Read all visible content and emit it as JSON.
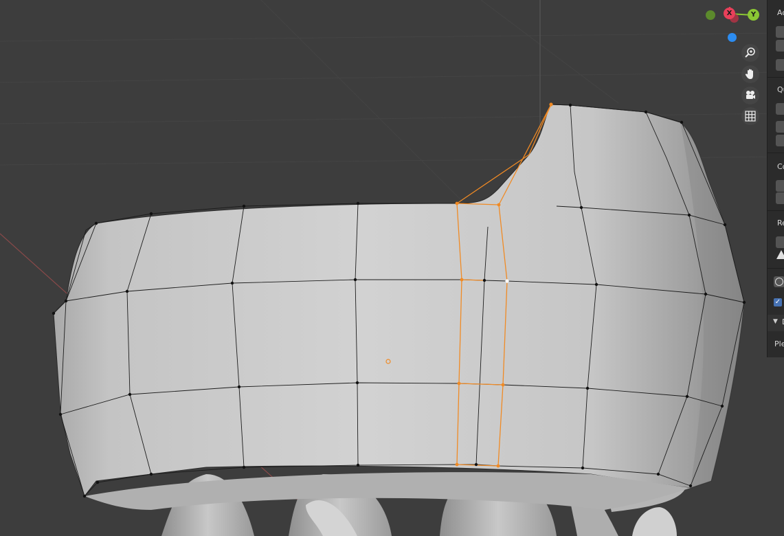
{
  "gizmo": {
    "x_label": "X",
    "y_label": "Y",
    "colors": {
      "x": "#e8405a",
      "y": "#8bc734",
      "z": "#2c8cf0",
      "neg_y": "#5c8a2c",
      "neg_x": "#a03444"
    }
  },
  "nav_tools": [
    {
      "name": "zoom-icon",
      "label": "Zoom"
    },
    {
      "name": "pan-hand-icon",
      "label": "Pan"
    },
    {
      "name": "camera-icon",
      "label": "Camera view"
    },
    {
      "name": "grid-icon",
      "label": "Orthographic toggle"
    }
  ],
  "sidebar": {
    "sections": [
      {
        "label": "Ac"
      },
      {
        "label": "Qu"
      },
      {
        "label": "Co"
      },
      {
        "label": "Re"
      }
    ],
    "collapsed_header": "D",
    "footer_text": "Ple"
  },
  "colors": {
    "viewport_bg": "#3d3d3d",
    "mesh_fill": "#c9c9c9",
    "edge": "#1a1a1a",
    "selected": "#f08a24"
  }
}
